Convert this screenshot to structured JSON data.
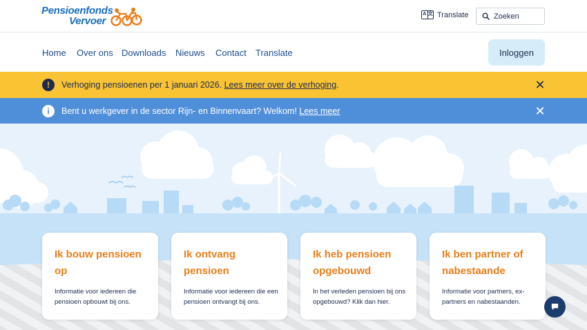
{
  "logo": {
    "line1": "Pensioenfonds",
    "line2": "Vervoer"
  },
  "topbar": {
    "translate_label": "Translate",
    "translate_icon": "translate-icon",
    "search_placeholder": "Zoeken",
    "search_icon": "search-icon"
  },
  "nav": {
    "items": [
      {
        "label": "Home"
      },
      {
        "label": "Over ons"
      },
      {
        "label": "Downloads"
      },
      {
        "label": "Nieuws"
      },
      {
        "label": "Contact"
      },
      {
        "label": "Translate"
      }
    ],
    "login_label": "Inloggen"
  },
  "alerts": {
    "yellow": {
      "icon": "!",
      "text": "Verhoging pensioenen per 1 januari 2026. ",
      "link": "Lees meer over de verhoging",
      "suffix": ".",
      "close": "✕"
    },
    "blue": {
      "icon": "i",
      "text": "Bent u werkgever in de sector Rijn- en Binnenvaart? Welkom! ",
      "link": "Lees meer",
      "close": "✕"
    }
  },
  "cards": [
    {
      "title_1": "Ik bouw pensioen",
      "title_2": "op",
      "desc": "Informatie voor iedereen die pensioen opbouwt bij ons."
    },
    {
      "title_1": "Ik ontvang",
      "title_2": "pensioen",
      "desc": "Informatie voor iedereen die een pensioen ontvangt bij ons."
    },
    {
      "title_1": "Ik heb pensioen",
      "title_2": "opgebouwd",
      "desc": "In het verleden pensioen bij ons opgebouwd? Klik dan hier."
    },
    {
      "title_1": "Ik ben partner of",
      "title_2": "nabestaande",
      "desc": "Informatie voor partners, ex-partners en nabestaanden."
    }
  ],
  "colors": {
    "brand_blue": "#1b6fc1",
    "accent_orange": "#ec7d19",
    "alert_yellow": "#f9c334",
    "alert_blue": "#4f8fd9",
    "login_bg": "#d6ecf9"
  },
  "chat": {
    "icon": "chat-icon"
  }
}
